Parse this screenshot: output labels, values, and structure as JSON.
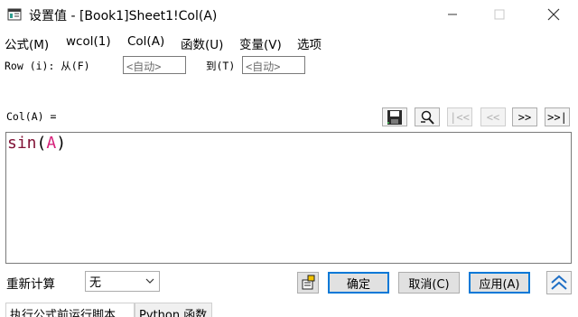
{
  "window": {
    "title": "设置值 - [Book1]Sheet1!Col(A)"
  },
  "menu": {
    "items": [
      {
        "label": "公式(M)"
      },
      {
        "label": "wcol(1)"
      },
      {
        "label": "Col(A)"
      },
      {
        "label": "函数(U)"
      },
      {
        "label": "变量(V)"
      },
      {
        "label": "选项"
      }
    ]
  },
  "row_range": {
    "label": "Row (i): 从(F)",
    "from_value": "<自动>",
    "to_label": "到(T)",
    "to_value": "<自动>"
  },
  "formula": {
    "label": "Col(A) =",
    "function": "sin",
    "open_paren": "(",
    "argument": "A",
    "close_paren": ")"
  },
  "nav": {
    "first": "|<<",
    "prev": "<<",
    "next": ">>",
    "last": ">>|"
  },
  "recalculate": {
    "label": "重新计算",
    "selected": "无"
  },
  "buttons": {
    "ok": "确定",
    "cancel": "取消(C)",
    "apply": "应用(A)"
  },
  "tabs": [
    {
      "label": "执行公式前运行脚本"
    },
    {
      "label": "Python 函数"
    }
  ],
  "colors": {
    "function": "#7f1034",
    "argument": "#d6207a",
    "default_border": "#0078d7"
  }
}
